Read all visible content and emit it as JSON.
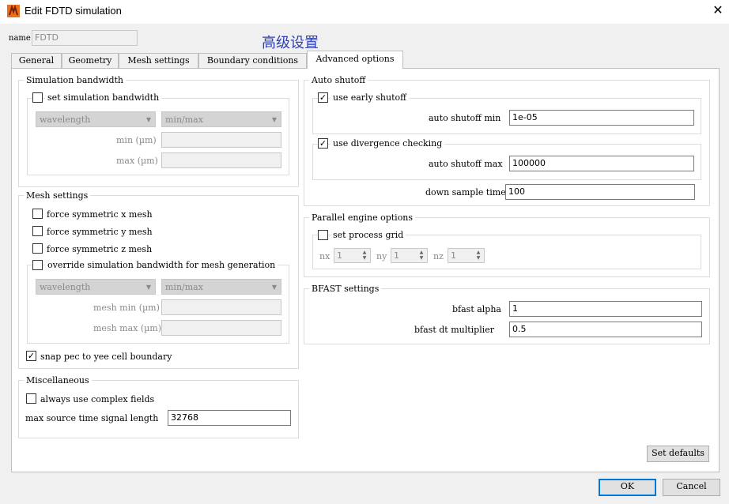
{
  "window": {
    "title": "Edit FDTD simulation",
    "close_glyph": "✕",
    "icon": "app-logo-icon"
  },
  "name_field": {
    "label": "name",
    "value": "FDTD"
  },
  "annotation": "高级设置",
  "tabs": [
    {
      "label": "General",
      "active": false
    },
    {
      "label": "Geometry",
      "active": false
    },
    {
      "label": "Mesh settings",
      "active": false
    },
    {
      "label": "Boundary conditions",
      "active": false
    },
    {
      "label": "Advanced options",
      "active": true
    }
  ],
  "simulation_bandwidth": {
    "title": "Simulation bandwidth",
    "checkbox_label": "set simulation bandwidth",
    "checked": false,
    "unit_select": "wavelength",
    "range_select": "min/max",
    "min_label": "min (µm)",
    "max_label": "max (µm)",
    "min_value": "",
    "max_value": ""
  },
  "mesh_settings": {
    "title": "Mesh settings",
    "force_x": {
      "label": "force symmetric x mesh",
      "checked": false
    },
    "force_y": {
      "label": "force symmetric y mesh",
      "checked": false
    },
    "force_z": {
      "label": "force symmetric z mesh",
      "checked": false
    },
    "override": {
      "label": "override simulation bandwidth for mesh generation",
      "checked": false
    },
    "unit_select": "wavelength",
    "range_select": "min/max",
    "mesh_min_label": "mesh min (µm)",
    "mesh_max_label": "mesh max (µm)",
    "snap": {
      "label": "snap pec to yee cell boundary",
      "checked": true
    }
  },
  "miscellaneous": {
    "title": "Miscellaneous",
    "complex": {
      "label": "always use complex fields",
      "checked": false
    },
    "signal_label": "max source time signal length",
    "signal_value": "32768"
  },
  "auto_shutoff": {
    "title": "Auto shutoff",
    "early": {
      "label": "use early shutoff",
      "checked": true
    },
    "min_label": "auto shutoff min",
    "min_value": "1e-05",
    "divergence": {
      "label": "use divergence checking",
      "checked": true
    },
    "max_label": "auto shutoff max",
    "max_value": "100000",
    "down_label": "down sample time",
    "down_value": "100"
  },
  "parallel_engine": {
    "title": "Parallel engine options",
    "grid": {
      "label": "set process grid",
      "checked": false
    },
    "nx_label": "nx",
    "nx_value": "1",
    "ny_label": "ny",
    "ny_value": "1",
    "nz_label": "nz",
    "nz_value": "1"
  },
  "bfast": {
    "title": "BFAST settings",
    "alpha_label": "bfast alpha",
    "alpha_value": "1",
    "dt_label": "bfast dt multiplier",
    "dt_value": "0.5"
  },
  "buttons": {
    "set_defaults": "Set defaults",
    "ok": "OK",
    "cancel": "Cancel"
  },
  "glyphs": {
    "check": "✓",
    "dropdown": "▼",
    "spin_up": "▲",
    "spin_down": "▼"
  },
  "colors": {
    "accent": "#0078d7",
    "annotation": "#2f3fb0",
    "logo_orange": "#e8701a"
  }
}
